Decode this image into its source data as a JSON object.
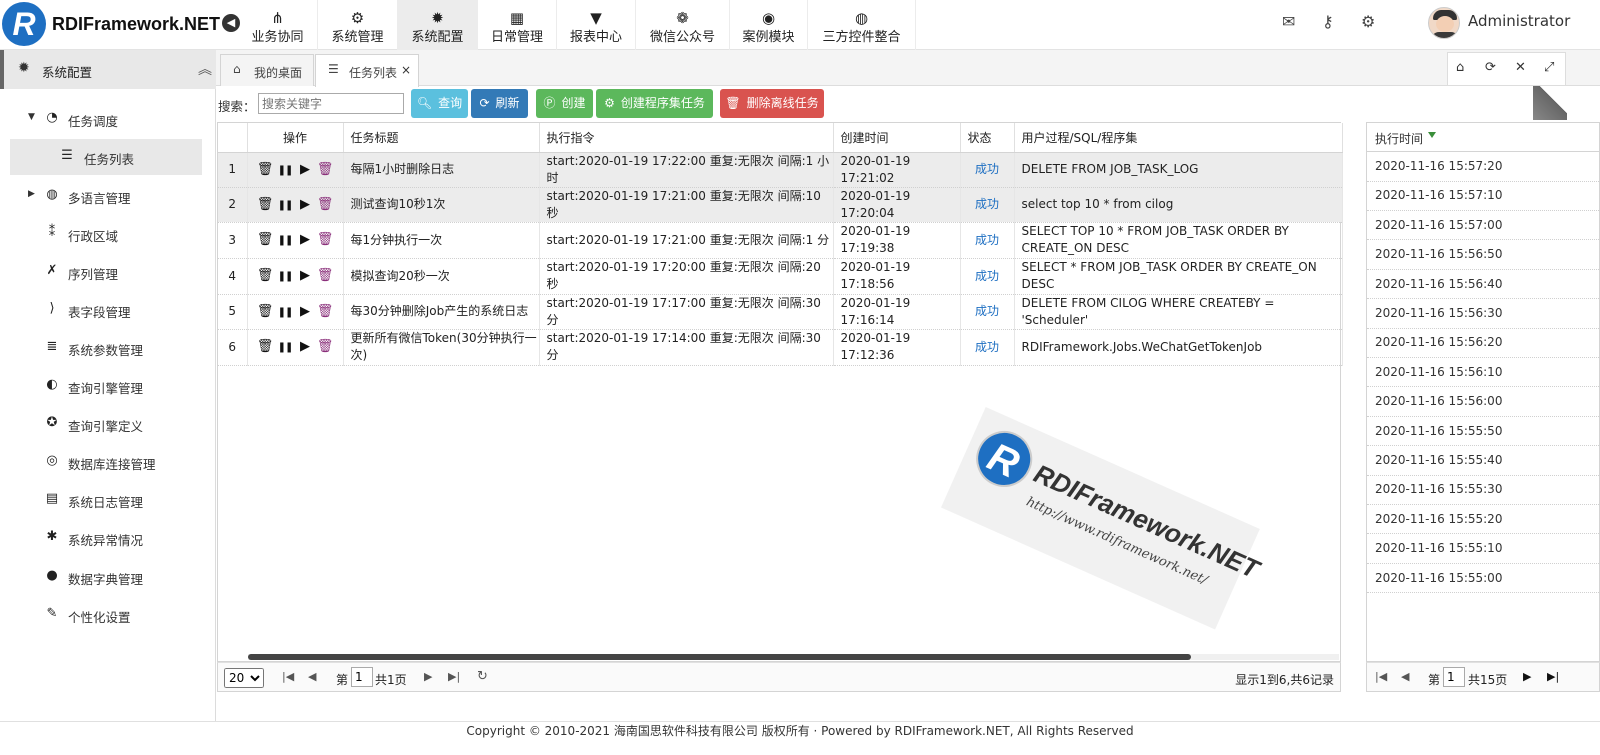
{
  "app": {
    "logo_letter": "R",
    "brand": "RDIFramework.NET",
    "user_name": "Administrator"
  },
  "topnav": [
    {
      "label": "业务协同",
      "icon": "share-icon",
      "glyph": "⋔",
      "active": false
    },
    {
      "label": "系统管理",
      "icon": "cogs-icon",
      "glyph": "⚙",
      "active": false
    },
    {
      "label": "系统配置",
      "icon": "gear-icon",
      "glyph": "✹",
      "active": true
    },
    {
      "label": "日常管理",
      "icon": "calendar-icon",
      "glyph": "▦",
      "active": false
    },
    {
      "label": "报表中心",
      "icon": "filter-icon",
      "glyph": "▼",
      "active": false
    },
    {
      "label": "微信公众号",
      "icon": "wechat-icon",
      "glyph": "❁",
      "active": false
    },
    {
      "label": "案例模块",
      "icon": "eye-icon",
      "glyph": "◉",
      "active": false
    },
    {
      "label": "三方控件整合",
      "icon": "globe-icon",
      "glyph": "◍",
      "active": false
    }
  ],
  "sidebar": {
    "title": "系统配置",
    "items": [
      {
        "label": "任务调度",
        "icon": "clock-icon",
        "glyph": "◔",
        "expanded": true
      },
      {
        "label": "任务列表",
        "icon": "list-icon",
        "glyph": "☰",
        "sub": true
      },
      {
        "label": "多语言管理",
        "icon": "globe-icon",
        "glyph": "◍",
        "collapsed": true
      },
      {
        "label": "行政区域",
        "icon": "map-pin-icon",
        "glyph": "⁑"
      },
      {
        "label": "序列管理",
        "icon": "x-square-icon",
        "glyph": "✗"
      },
      {
        "label": "表字段管理",
        "icon": "fields-icon",
        "glyph": "⟩"
      },
      {
        "label": "系统参数管理",
        "icon": "stack-icon",
        "glyph": "≣"
      },
      {
        "label": "查询引擎管理",
        "icon": "compass-icon",
        "glyph": "◐"
      },
      {
        "label": "查询引擎定义",
        "icon": "rebel-icon",
        "glyph": "✪"
      },
      {
        "label": "数据库连接管理",
        "icon": "database-icon",
        "glyph": "◎"
      },
      {
        "label": "系统日志管理",
        "icon": "file-icon",
        "glyph": "▤"
      },
      {
        "label": "系统异常情况",
        "icon": "bug-icon",
        "glyph": "✱"
      },
      {
        "label": "数据字典管理",
        "icon": "bomb-icon",
        "glyph": "●"
      },
      {
        "label": "个性化设置",
        "icon": "wrench-icon",
        "glyph": "✎"
      }
    ]
  },
  "tabs": [
    {
      "label": "我的桌面",
      "icon": "home-icon",
      "glyph": "⌂",
      "active": false
    },
    {
      "label": "任务列表",
      "icon": "list-icon",
      "glyph": "☰",
      "active": true,
      "close": "×"
    }
  ],
  "toolbar": {
    "search_label": "搜索：",
    "search_placeholder": "搜索关键字",
    "buttons": [
      {
        "label": "查询",
        "icon": "search-icon",
        "glyph": "🔍︎",
        "color": "#5bc0de"
      },
      {
        "label": "刷新",
        "icon": "refresh-icon",
        "glyph": "⟳",
        "color": "#337ab7"
      },
      {
        "label": "创建",
        "icon": "create-icon",
        "glyph": "Ⓟ",
        "color": "#5cb85c"
      },
      {
        "label": "创建程序集任务",
        "icon": "gear-icon",
        "glyph": "⚙",
        "color": "#5cb85c"
      },
      {
        "label": "删除离线任务",
        "icon": "trash-icon",
        "glyph": "🗑︎",
        "color": "#d9534f"
      }
    ]
  },
  "grid": {
    "columns": [
      "",
      "操作",
      "任务标题",
      "执行指令",
      "创建时间",
      "状态",
      "用户过程/SQL/程序集"
    ],
    "rows": [
      {
        "num": "1",
        "title": "每隔1小时删除日志",
        "cmd": "start:2020-01-19 17:22:00 重复:无限次 间隔:1 小时",
        "created": "2020-01-19 17:21:02",
        "status": "成功",
        "proc": "DELETE FROM JOB_TASK_LOG",
        "hl": true
      },
      {
        "num": "2",
        "title": "测试查询10秒1次",
        "cmd": "start:2020-01-19 17:21:00 重复:无限次 间隔:10 秒",
        "created": "2020-01-19 17:20:04",
        "status": "成功",
        "proc": "select top 10 * from cilog",
        "hl": true
      },
      {
        "num": "3",
        "title": "每1分钟执行一次",
        "cmd": "start:2020-01-19 17:21:00 重复:无限次 间隔:1 分",
        "created": "2020-01-19 17:19:38",
        "status": "成功",
        "proc": "SELECT TOP 10 * FROM JOB_TASK ORDER BY CREATE_ON DESC",
        "hl": false
      },
      {
        "num": "4",
        "title": "模拟查询20秒一次",
        "cmd": "start:2020-01-19 17:20:00 重复:无限次 间隔:20 秒",
        "created": "2020-01-19 17:18:56",
        "status": "成功",
        "proc": "SELECT * FROM JOB_TASK ORDER BY CREATE_ON DESC",
        "hl": false
      },
      {
        "num": "5",
        "title": "每30分钟删除Job产生的系统日志",
        "cmd": "start:2020-01-19 17:17:00 重复:无限次 间隔:30 分",
        "created": "2020-01-19 17:16:14",
        "status": "成功",
        "proc": "DELETE FROM CILOG WHERE CREATEBY = 'Scheduler'",
        "hl": false
      },
      {
        "num": "6",
        "title": "更新所有微信Token(30分钟执行一次)",
        "cmd": "start:2020-01-19 17:14:00 重复:无限次 间隔:30 分",
        "created": "2020-01-19 17:12:36",
        "status": "成功",
        "proc": "RDIFramework.Jobs.WeChatGetTokenJob",
        "hl": false
      }
    ]
  },
  "pager": {
    "page_size": "20",
    "page_prefix": "第",
    "page_value": "1",
    "page_total": "共1页",
    "info": "显示1到6,共6记录"
  },
  "right_panel": {
    "header": "执行时间",
    "times": [
      "2020-11-16 15:57:20",
      "2020-11-16 15:57:10",
      "2020-11-16 15:57:00",
      "2020-11-16 15:56:50",
      "2020-11-16 15:56:40",
      "2020-11-16 15:56:30",
      "2020-11-16 15:56:20",
      "2020-11-16 15:56:10",
      "2020-11-16 15:56:00",
      "2020-11-16 15:55:50",
      "2020-11-16 15:55:40",
      "2020-11-16 15:55:30",
      "2020-11-16 15:55:20",
      "2020-11-16 15:55:10",
      "2020-11-16 15:55:00"
    ],
    "page_prefix": "第",
    "page_value": "1",
    "page_total": "共15页"
  },
  "watermark": {
    "title": "RDIFramework.NET",
    "url": "http://www.rdiframework.net/"
  },
  "footer": "Copyright © 2010-2021 海南国思软件科技有限公司 版权所有 · Powered by RDIFramework.NET, All Rights Reserved"
}
